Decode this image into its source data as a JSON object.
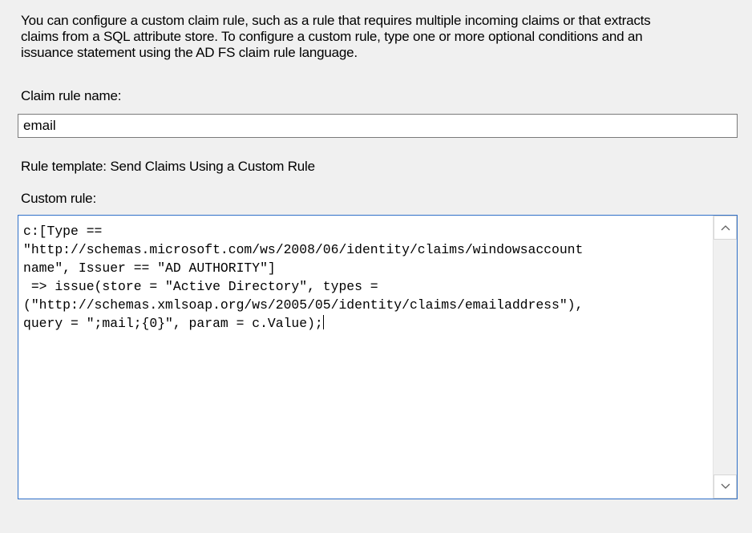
{
  "description": {
    "lines": [
      "You can configure a custom claim rule, such as a rule that requires multiple incoming claims or that extracts",
      "claims from a SQL attribute store. To configure a custom rule, type one or more optional conditions and an",
      "issuance statement using the AD FS claim rule language."
    ]
  },
  "claim_rule_name": {
    "label": "Claim rule name:",
    "value": "email"
  },
  "rule_template": {
    "label": "Rule template: Send Claims Using a Custom Rule"
  },
  "custom_rule": {
    "label": "Custom rule:",
    "lines": [
      "c:[Type ==",
      "\"http://schemas.microsoft.com/ws/2008/06/identity/claims/windowsaccount",
      "name\", Issuer == \"AD AUTHORITY\"]",
      " => issue(store = \"Active Directory\", types =",
      "(\"http://schemas.xmlsoap.org/ws/2005/05/identity/claims/emailaddress\"),",
      "query = \";mail;{0}\", param = c.Value);"
    ]
  },
  "icons": {
    "scroll_up": "chevron-up-icon",
    "scroll_down": "chevron-down-icon"
  },
  "colors": {
    "focus_border": "#2f6fc8",
    "background": "#f0f0f0"
  }
}
